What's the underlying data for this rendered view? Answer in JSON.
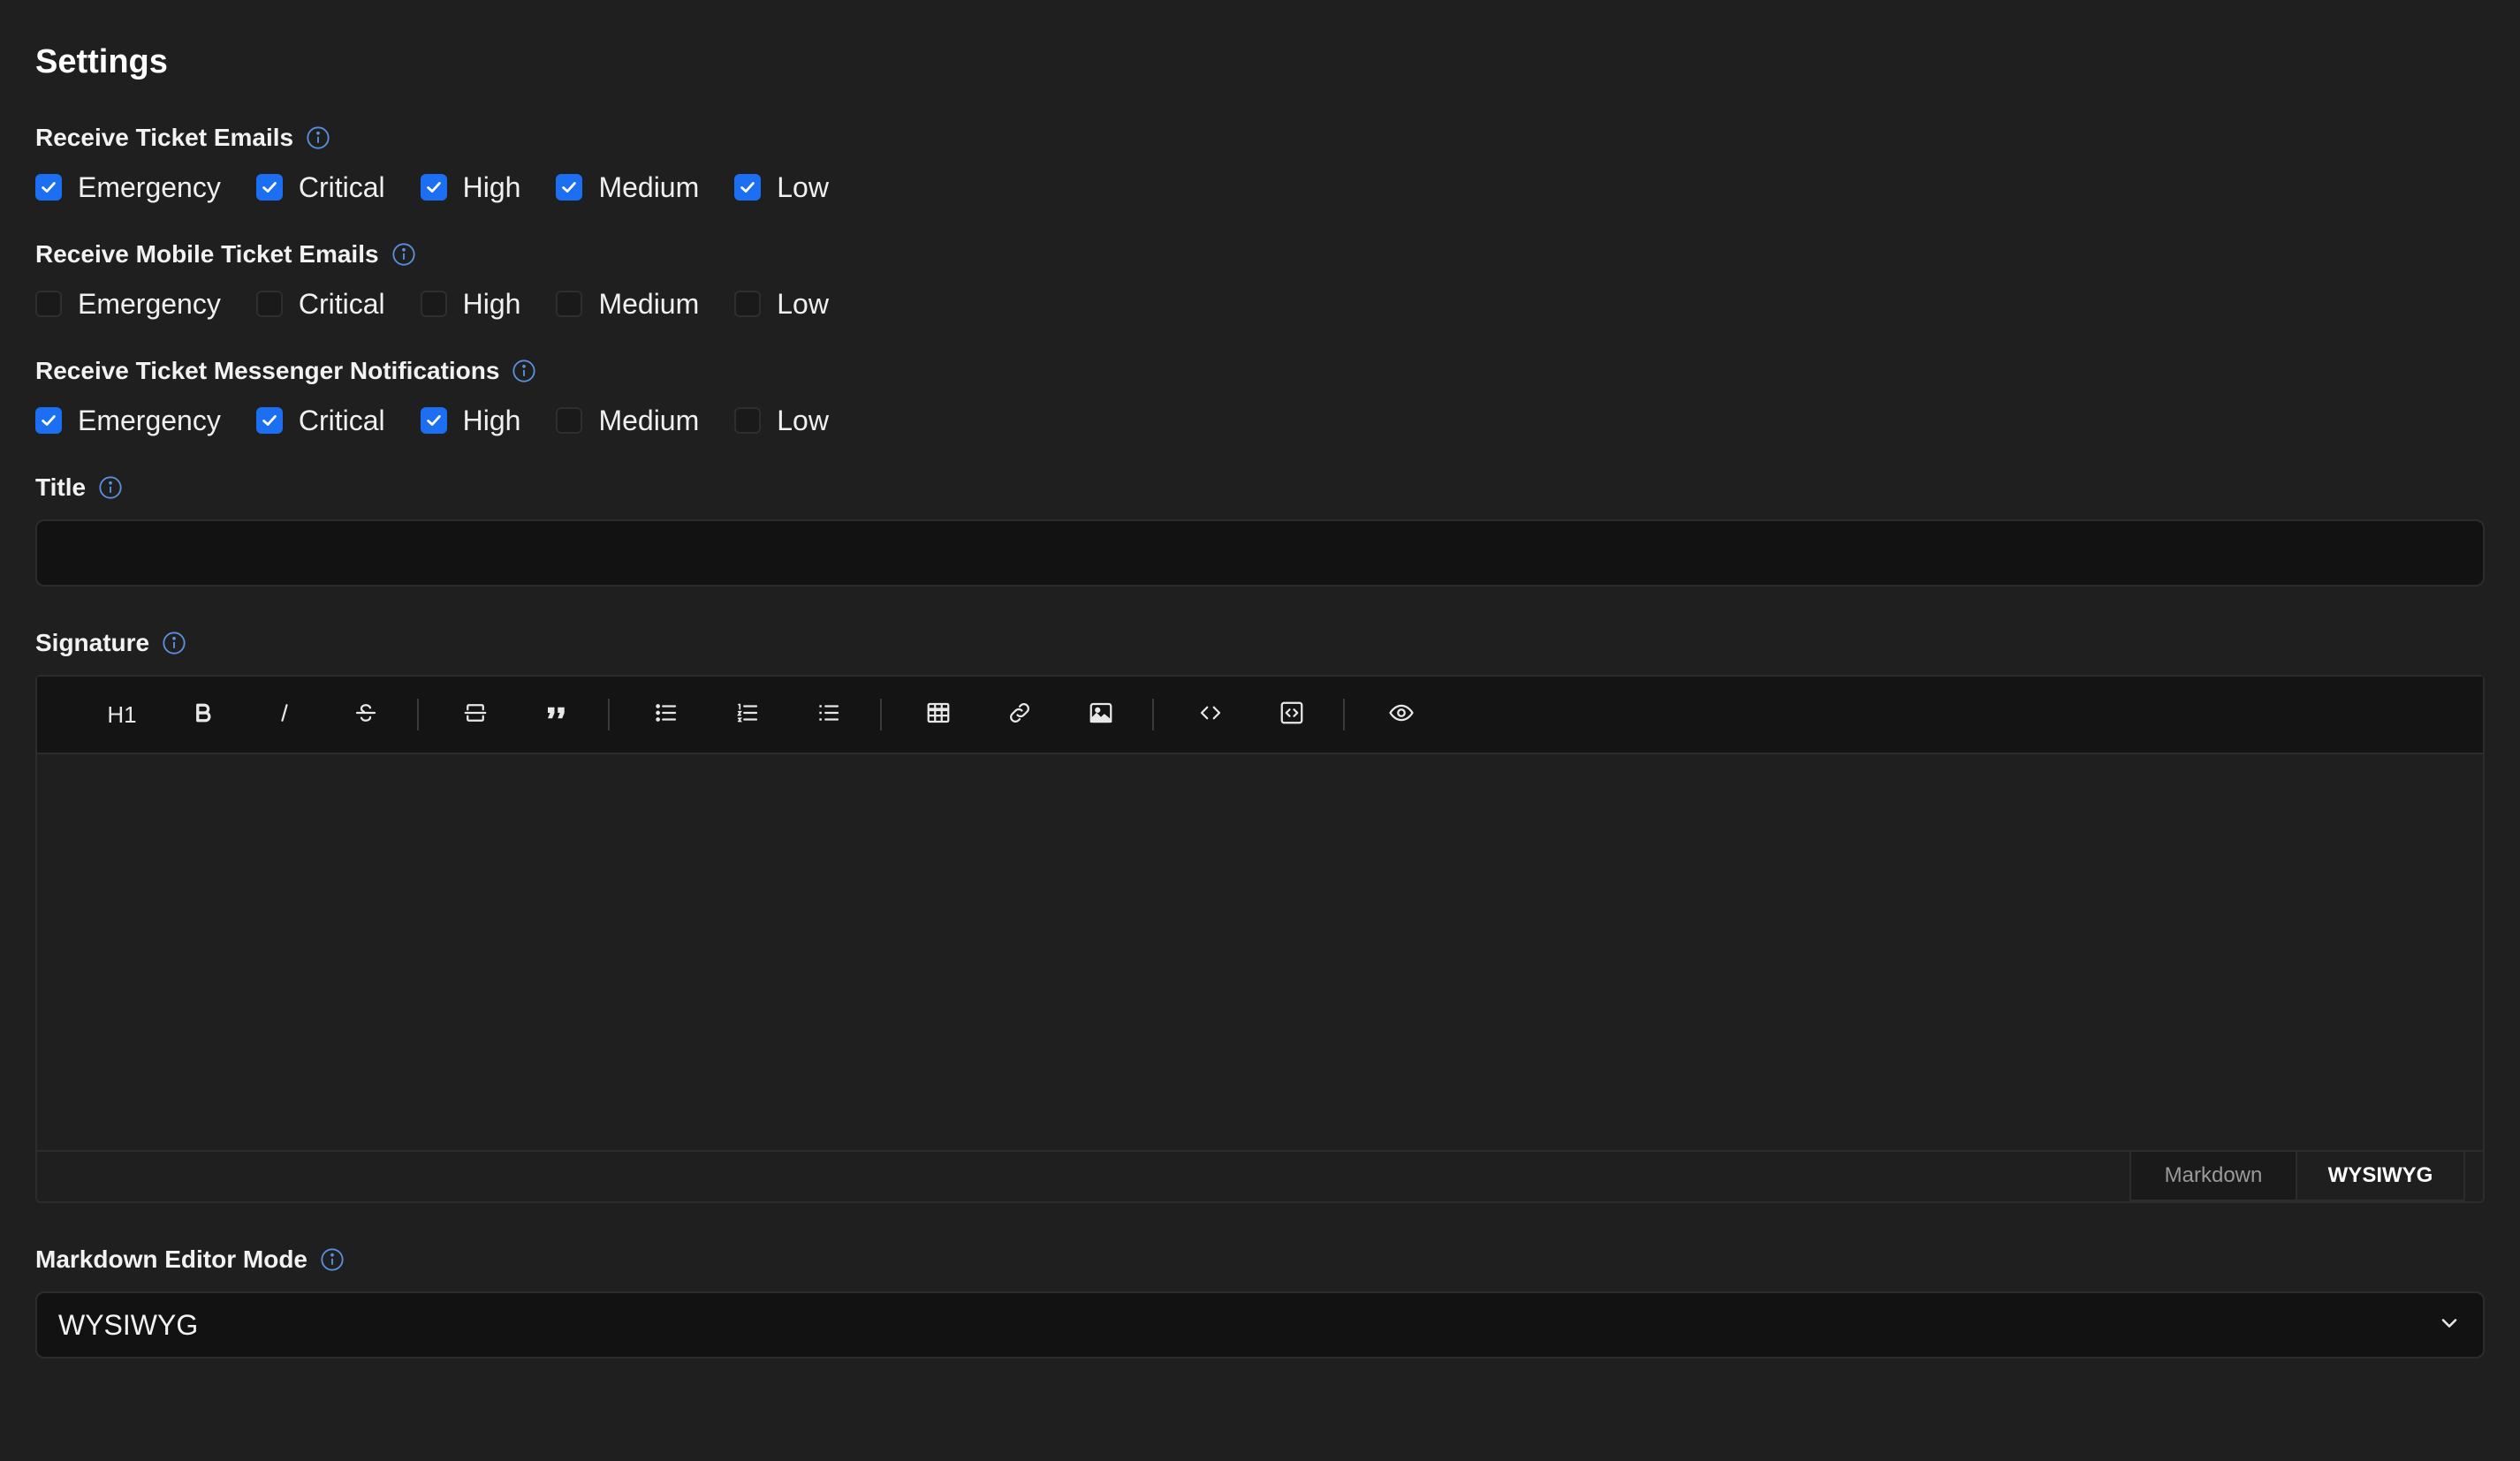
{
  "page": {
    "title": "Settings"
  },
  "groups": [
    {
      "label": "Receive Ticket Emails",
      "options": [
        {
          "label": "Emergency",
          "checked": true
        },
        {
          "label": "Critical",
          "checked": true
        },
        {
          "label": "High",
          "checked": true
        },
        {
          "label": "Medium",
          "checked": true
        },
        {
          "label": "Low",
          "checked": true
        }
      ]
    },
    {
      "label": "Receive Mobile Ticket Emails",
      "options": [
        {
          "label": "Emergency",
          "checked": false
        },
        {
          "label": "Critical",
          "checked": false
        },
        {
          "label": "High",
          "checked": false
        },
        {
          "label": "Medium",
          "checked": false
        },
        {
          "label": "Low",
          "checked": false
        }
      ]
    },
    {
      "label": "Receive Ticket Messenger Notifications",
      "options": [
        {
          "label": "Emergency",
          "checked": true
        },
        {
          "label": "Critical",
          "checked": true
        },
        {
          "label": "High",
          "checked": true
        },
        {
          "label": "Medium",
          "checked": false
        },
        {
          "label": "Low",
          "checked": false
        }
      ]
    }
  ],
  "title_field": {
    "label": "Title",
    "value": "",
    "placeholder": ""
  },
  "signature": {
    "label": "Signature",
    "toolbar": {
      "h1_label": "H1",
      "icons": [
        "bold-icon",
        "italic-icon",
        "strikethrough-icon",
        "horizontal-rule-icon",
        "quote-icon",
        "bullet-list-icon",
        "ordered-list-icon",
        "task-list-icon",
        "table-icon",
        "link-icon",
        "image-icon",
        "code-icon",
        "code-block-icon",
        "preview-eye-icon"
      ]
    },
    "modes": {
      "markdown": "Markdown",
      "wysiwyg": "WYSIWYG",
      "active": "WYSIWYG"
    }
  },
  "editor_mode": {
    "label": "Markdown Editor Mode",
    "selected": "WYSIWYG"
  },
  "colors": {
    "background": "#1f1f1f",
    "input_background": "#121212",
    "accent": "#1c6ef2",
    "info_icon": "#5a8fdc"
  }
}
